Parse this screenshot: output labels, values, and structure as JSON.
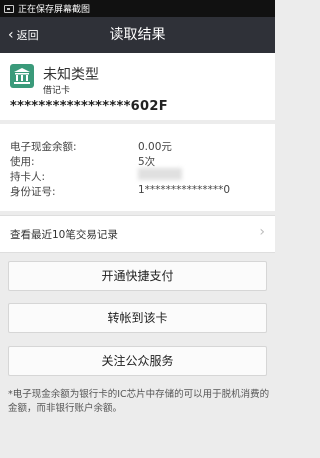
{
  "status_bar": {
    "text": "正在保存屏幕截图",
    "icon": "screenshot-icon"
  },
  "nav": {
    "back_label": "返回",
    "title": "读取结果",
    "back_icon": "chevron-left-icon"
  },
  "card": {
    "logo_icon": "bank-icon",
    "logo_color": "#3a9a7a",
    "type": "未知类型",
    "subtype": "借记卡",
    "number": "*****************602F"
  },
  "info": {
    "balance_label": "电子现金余额:",
    "balance_value": "0.00元",
    "usage_label": "使用:",
    "usage_value": "5次",
    "holder_label": "持卡人:",
    "id_label": "身份证号:",
    "id_value": "1***************0"
  },
  "transactions": {
    "label": "查看最近10笔交易记录"
  },
  "buttons": {
    "quick_pay": "开通快捷支付",
    "transfer": "转帐到该卡",
    "follow": "关注公众服务"
  },
  "note": "*电子现金余额为银行卡的IC芯片中存储的可以用于脱机消费的金额，而非银行账户余额。"
}
